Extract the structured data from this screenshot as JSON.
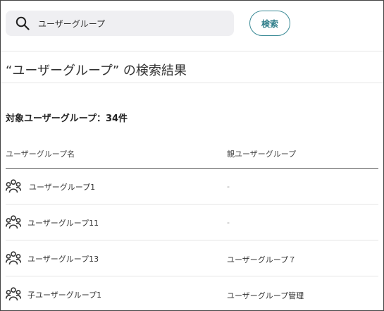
{
  "search": {
    "value": "ユーザーグループ",
    "button_label": "検索"
  },
  "results": {
    "heading": "“ユーザーグループ” の検索結果",
    "count_label": "対象ユーザーグループ：34件"
  },
  "table": {
    "columns": [
      "ユーザーグループ名",
      "親ユーザーグループ"
    ],
    "rows": [
      {
        "name": "ユーザーグループ1",
        "parent": "-"
      },
      {
        "name": "ユーザーグループ11",
        "parent": "-"
      },
      {
        "name": "ユーザーグループ13",
        "parent": "ユーザーグループ７"
      },
      {
        "name": "子ユーザーグループ1",
        "parent": "ユーザーグループ管理"
      }
    ],
    "row_icon": "group-icon"
  }
}
